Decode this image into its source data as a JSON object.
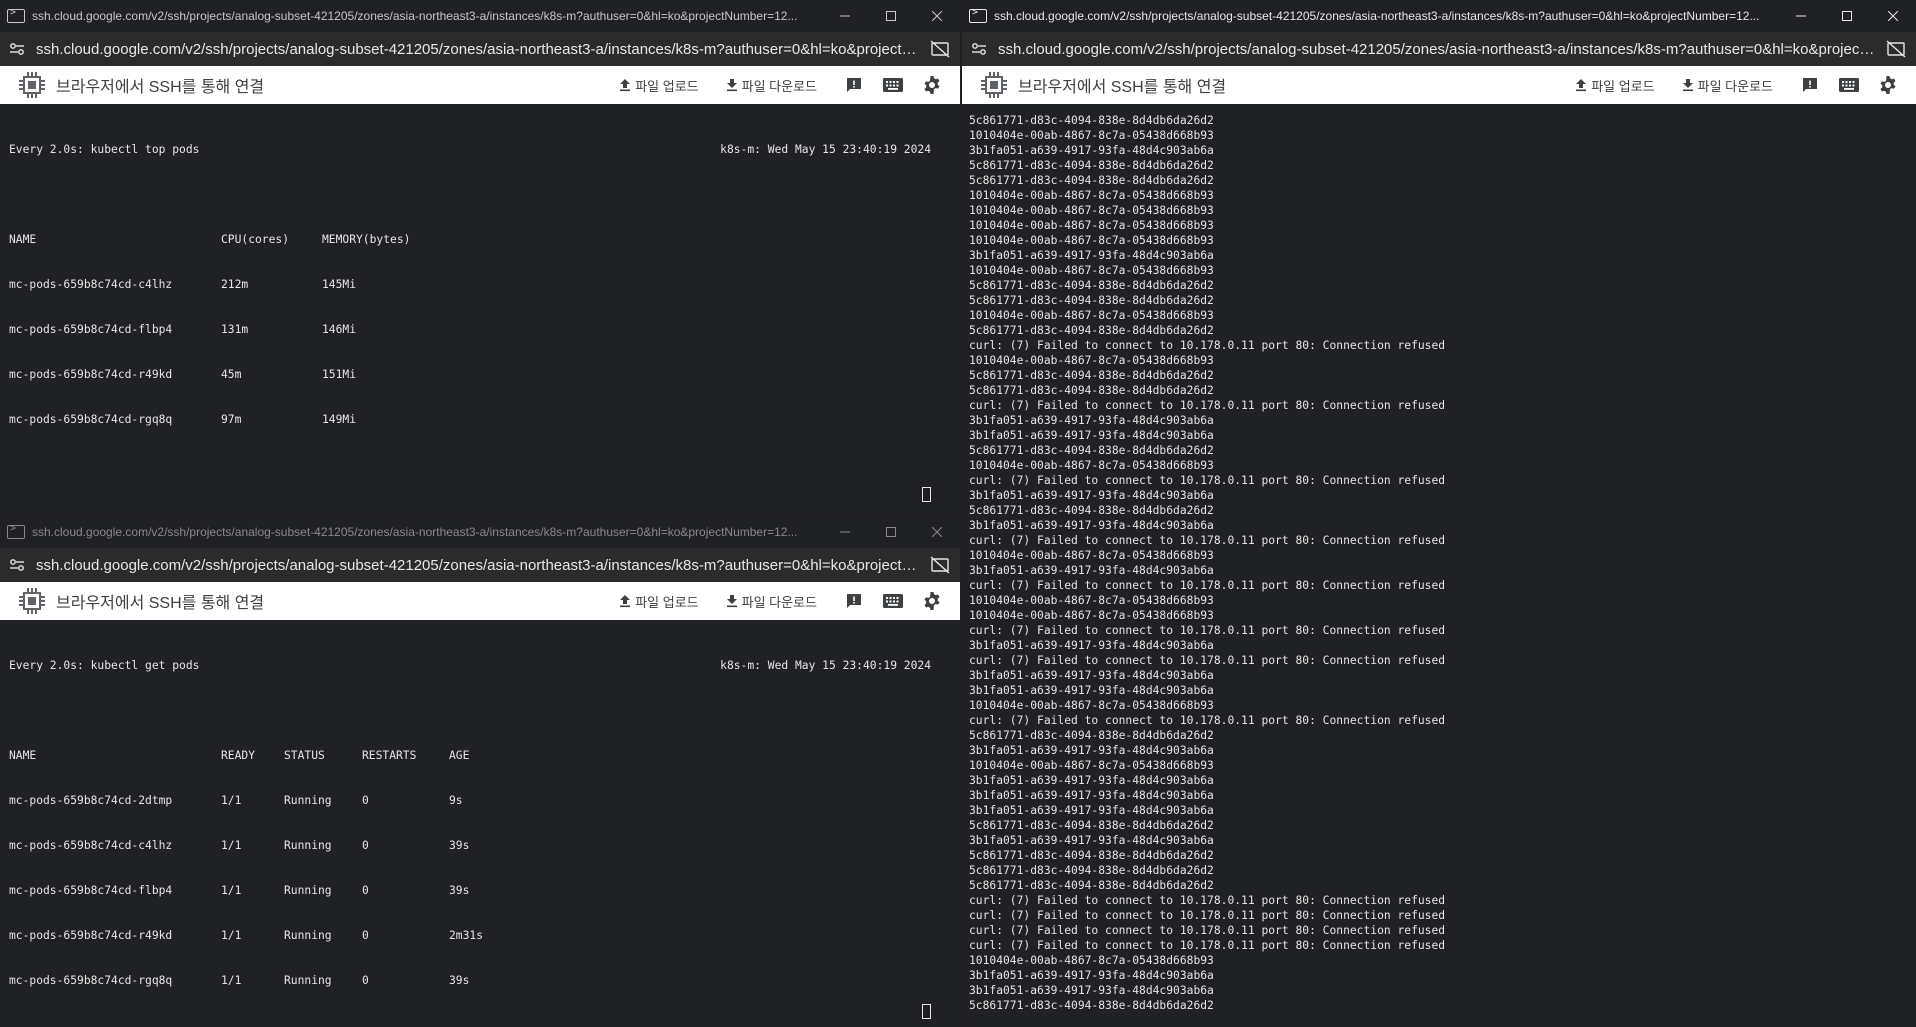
{
  "windows": [
    {
      "id": "tl",
      "title": "ssh.cloud.google.com/v2/ssh/projects/analog-subset-421205/zones/asia-northeast3-a/instances/k8s-m?authuser=0&hl=ko&projectNumber=12...",
      "url": "ssh.cloud.google.com/v2/ssh/projects/analog-subset-421205/zones/asia-northeast3-a/instances/k8s-m?authuser=0&hl=ko&projectNu...",
      "toolbar_title": "브라우저에서 SSH를 통해 연결",
      "upload_label": "파일 업로드",
      "download_label": "파일 다운로드",
      "watch_cmd": "Every 2.0s: kubectl top pods",
      "watch_host": "k8s-m: Wed May 15 23:40:19 2024",
      "columns": [
        "NAME",
        "CPU(cores)",
        "MEMORY(bytes)"
      ],
      "rows": [
        [
          "mc-pods-659b8c74cd-c4lhz",
          "212m",
          "145Mi"
        ],
        [
          "mc-pods-659b8c74cd-flbp4",
          "131m",
          "146Mi"
        ],
        [
          "mc-pods-659b8c74cd-r49kd",
          "45m",
          "151Mi"
        ],
        [
          "mc-pods-659b8c74cd-rgq8q",
          "97m",
          "149Mi"
        ]
      ]
    },
    {
      "id": "bl",
      "title": "ssh.cloud.google.com/v2/ssh/projects/analog-subset-421205/zones/asia-northeast3-a/instances/k8s-m?authuser=0&hl=ko&projectNumber=12...",
      "url": "ssh.cloud.google.com/v2/ssh/projects/analog-subset-421205/zones/asia-northeast3-a/instances/k8s-m?authuser=0&hl=ko&projectNu...",
      "toolbar_title": "브라우저에서 SSH를 통해 연결",
      "upload_label": "파일 업로드",
      "download_label": "파일 다운로드",
      "watch_cmd": "Every 2.0s: kubectl get pods",
      "watch_host": "k8s-m: Wed May 15 23:40:19 2024",
      "columns": [
        "NAME",
        "READY",
        "STATUS",
        "RESTARTS",
        "AGE"
      ],
      "rows": [
        [
          "mc-pods-659b8c74cd-2dtmp",
          "1/1",
          "Running",
          "0",
          "9s"
        ],
        [
          "mc-pods-659b8c74cd-c4lhz",
          "1/1",
          "Running",
          "0",
          "39s"
        ],
        [
          "mc-pods-659b8c74cd-flbp4",
          "1/1",
          "Running",
          "0",
          "39s"
        ],
        [
          "mc-pods-659b8c74cd-r49kd",
          "1/1",
          "Running",
          "0",
          "2m31s"
        ],
        [
          "mc-pods-659b8c74cd-rgq8q",
          "1/1",
          "Running",
          "0",
          "39s"
        ]
      ]
    },
    {
      "id": "r",
      "title": "ssh.cloud.google.com/v2/ssh/projects/analog-subset-421205/zones/asia-northeast3-a/instances/k8s-m?authuser=0&hl=ko&projectNumber=12...",
      "url": "ssh.cloud.google.com/v2/ssh/projects/analog-subset-421205/zones/asia-northeast3-a/instances/k8s-m?authuser=0&hl=ko&projectNu...",
      "toolbar_title": "브라우저에서 SSH를 통해 연결",
      "upload_label": "파일 업로드",
      "download_label": "파일 다운로드",
      "output_lines": [
        "5c861771-d83c-4094-838e-8d4db6da26d2",
        "1010404e-00ab-4867-8c7a-05438d668b93",
        "3b1fa051-a639-4917-93fa-48d4c903ab6a",
        "5c861771-d83c-4094-838e-8d4db6da26d2",
        "5c861771-d83c-4094-838e-8d4db6da26d2",
        "1010404e-00ab-4867-8c7a-05438d668b93",
        "1010404e-00ab-4867-8c7a-05438d668b93",
        "1010404e-00ab-4867-8c7a-05438d668b93",
        "1010404e-00ab-4867-8c7a-05438d668b93",
        "3b1fa051-a639-4917-93fa-48d4c903ab6a",
        "1010404e-00ab-4867-8c7a-05438d668b93",
        "5c861771-d83c-4094-838e-8d4db6da26d2",
        "5c861771-d83c-4094-838e-8d4db6da26d2",
        "1010404e-00ab-4867-8c7a-05438d668b93",
        "5c861771-d83c-4094-838e-8d4db6da26d2",
        "curl: (7) Failed to connect to 10.178.0.11 port 80: Connection refused",
        "1010404e-00ab-4867-8c7a-05438d668b93",
        "5c861771-d83c-4094-838e-8d4db6da26d2",
        "5c861771-d83c-4094-838e-8d4db6da26d2",
        "curl: (7) Failed to connect to 10.178.0.11 port 80: Connection refused",
        "3b1fa051-a639-4917-93fa-48d4c903ab6a",
        "3b1fa051-a639-4917-93fa-48d4c903ab6a",
        "5c861771-d83c-4094-838e-8d4db6da26d2",
        "1010404e-00ab-4867-8c7a-05438d668b93",
        "curl: (7) Failed to connect to 10.178.0.11 port 80: Connection refused",
        "3b1fa051-a639-4917-93fa-48d4c903ab6a",
        "5c861771-d83c-4094-838e-8d4db6da26d2",
        "3b1fa051-a639-4917-93fa-48d4c903ab6a",
        "curl: (7) Failed to connect to 10.178.0.11 port 80: Connection refused",
        "1010404e-00ab-4867-8c7a-05438d668b93",
        "3b1fa051-a639-4917-93fa-48d4c903ab6a",
        "curl: (7) Failed to connect to 10.178.0.11 port 80: Connection refused",
        "1010404e-00ab-4867-8c7a-05438d668b93",
        "1010404e-00ab-4867-8c7a-05438d668b93",
        "curl: (7) Failed to connect to 10.178.0.11 port 80: Connection refused",
        "3b1fa051-a639-4917-93fa-48d4c903ab6a",
        "curl: (7) Failed to connect to 10.178.0.11 port 80: Connection refused",
        "3b1fa051-a639-4917-93fa-48d4c903ab6a",
        "3b1fa051-a639-4917-93fa-48d4c903ab6a",
        "1010404e-00ab-4867-8c7a-05438d668b93",
        "curl: (7) Failed to connect to 10.178.0.11 port 80: Connection refused",
        "5c861771-d83c-4094-838e-8d4db6da26d2",
        "3b1fa051-a639-4917-93fa-48d4c903ab6a",
        "1010404e-00ab-4867-8c7a-05438d668b93",
        "3b1fa051-a639-4917-93fa-48d4c903ab6a",
        "3b1fa051-a639-4917-93fa-48d4c903ab6a",
        "3b1fa051-a639-4917-93fa-48d4c903ab6a",
        "5c861771-d83c-4094-838e-8d4db6da26d2",
        "3b1fa051-a639-4917-93fa-48d4c903ab6a",
        "5c861771-d83c-4094-838e-8d4db6da26d2",
        "5c861771-d83c-4094-838e-8d4db6da26d2",
        "5c861771-d83c-4094-838e-8d4db6da26d2",
        "curl: (7) Failed to connect to 10.178.0.11 port 80: Connection refused",
        "curl: (7) Failed to connect to 10.178.0.11 port 80: Connection refused",
        "curl: (7) Failed to connect to 10.178.0.11 port 80: Connection refused",
        "curl: (7) Failed to connect to 10.178.0.11 port 80: Connection refused",
        "1010404e-00ab-4867-8c7a-05438d668b93",
        "3b1fa051-a639-4917-93fa-48d4c903ab6a",
        "3b1fa051-a639-4917-93fa-48d4c903ab6a",
        "5c861771-d83c-4094-838e-8d4db6da26d2"
      ]
    }
  ],
  "colors": {
    "terminal_bg": "#202124",
    "terminal_fg": "#e6e6e6",
    "toolbar_bg": "#ffffff",
    "urlbar_bg": "#2b2b2b"
  },
  "icons": {
    "app": "terminal-app-icon",
    "site_settings": "site-settings-icon",
    "cast_off": "cast-off-icon",
    "chip": "compute-chip-icon",
    "upload": "upload-icon",
    "download": "download-icon",
    "feedback": "feedback-icon",
    "keyboard": "keyboard-icon",
    "settings": "gear-icon"
  }
}
